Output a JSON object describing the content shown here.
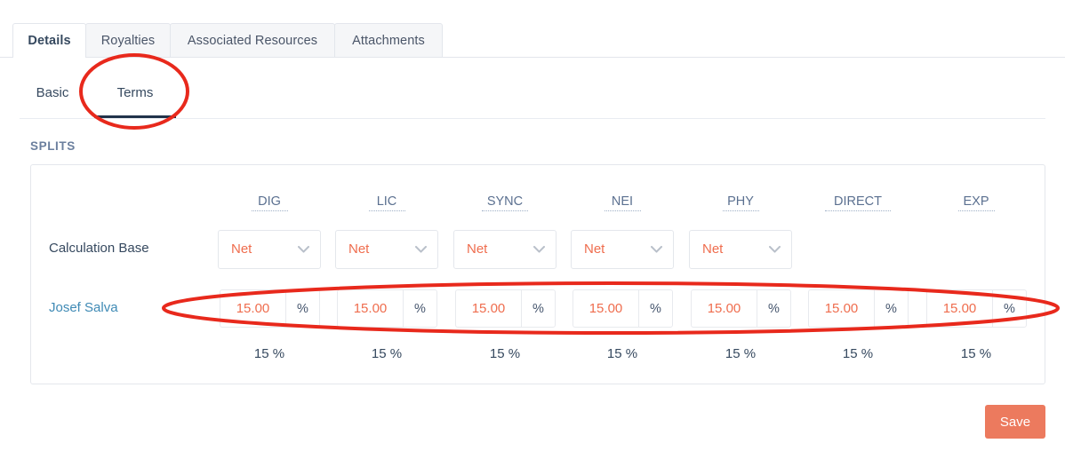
{
  "tabs": [
    {
      "label": "Details",
      "active": true
    },
    {
      "label": "Royalties",
      "active": false
    },
    {
      "label": "Associated Resources",
      "active": false
    },
    {
      "label": "Attachments",
      "active": false
    }
  ],
  "subtabs": [
    {
      "label": "Basic",
      "active": false
    },
    {
      "label": "Terms",
      "active": true
    }
  ],
  "splits": {
    "section_label": "SPLITS",
    "columns": [
      "DIG",
      "LIC",
      "SYNC",
      "NEI",
      "PHY",
      "DIRECT",
      "EXP"
    ],
    "calculation_base": {
      "row_label": "Calculation Base",
      "values": [
        "Net",
        "Net",
        "Net",
        "Net",
        "Net"
      ]
    },
    "participant": {
      "name": "Josef Salva",
      "values": [
        "15.00",
        "15.00",
        "15.00",
        "15.00",
        "15.00",
        "15.00",
        "15.00"
      ],
      "unit": "%"
    },
    "totals": [
      "15 %",
      "15 %",
      "15 %",
      "15 %",
      "15 %",
      "15 %",
      "15 %"
    ]
  },
  "footer": {
    "save_label": "Save"
  },
  "colors": {
    "accent_orange": "#ef6d4e",
    "save_button": "#ec7a5e",
    "link_blue": "#3f8ab5",
    "header_blue": "#5b7090",
    "annotation_red": "#e8291c",
    "active_underline": "#22334a"
  },
  "annotations": [
    {
      "name": "terms-tab-highlight",
      "shape": "ellipse"
    },
    {
      "name": "splits-inputs-highlight",
      "shape": "ellipse"
    }
  ]
}
